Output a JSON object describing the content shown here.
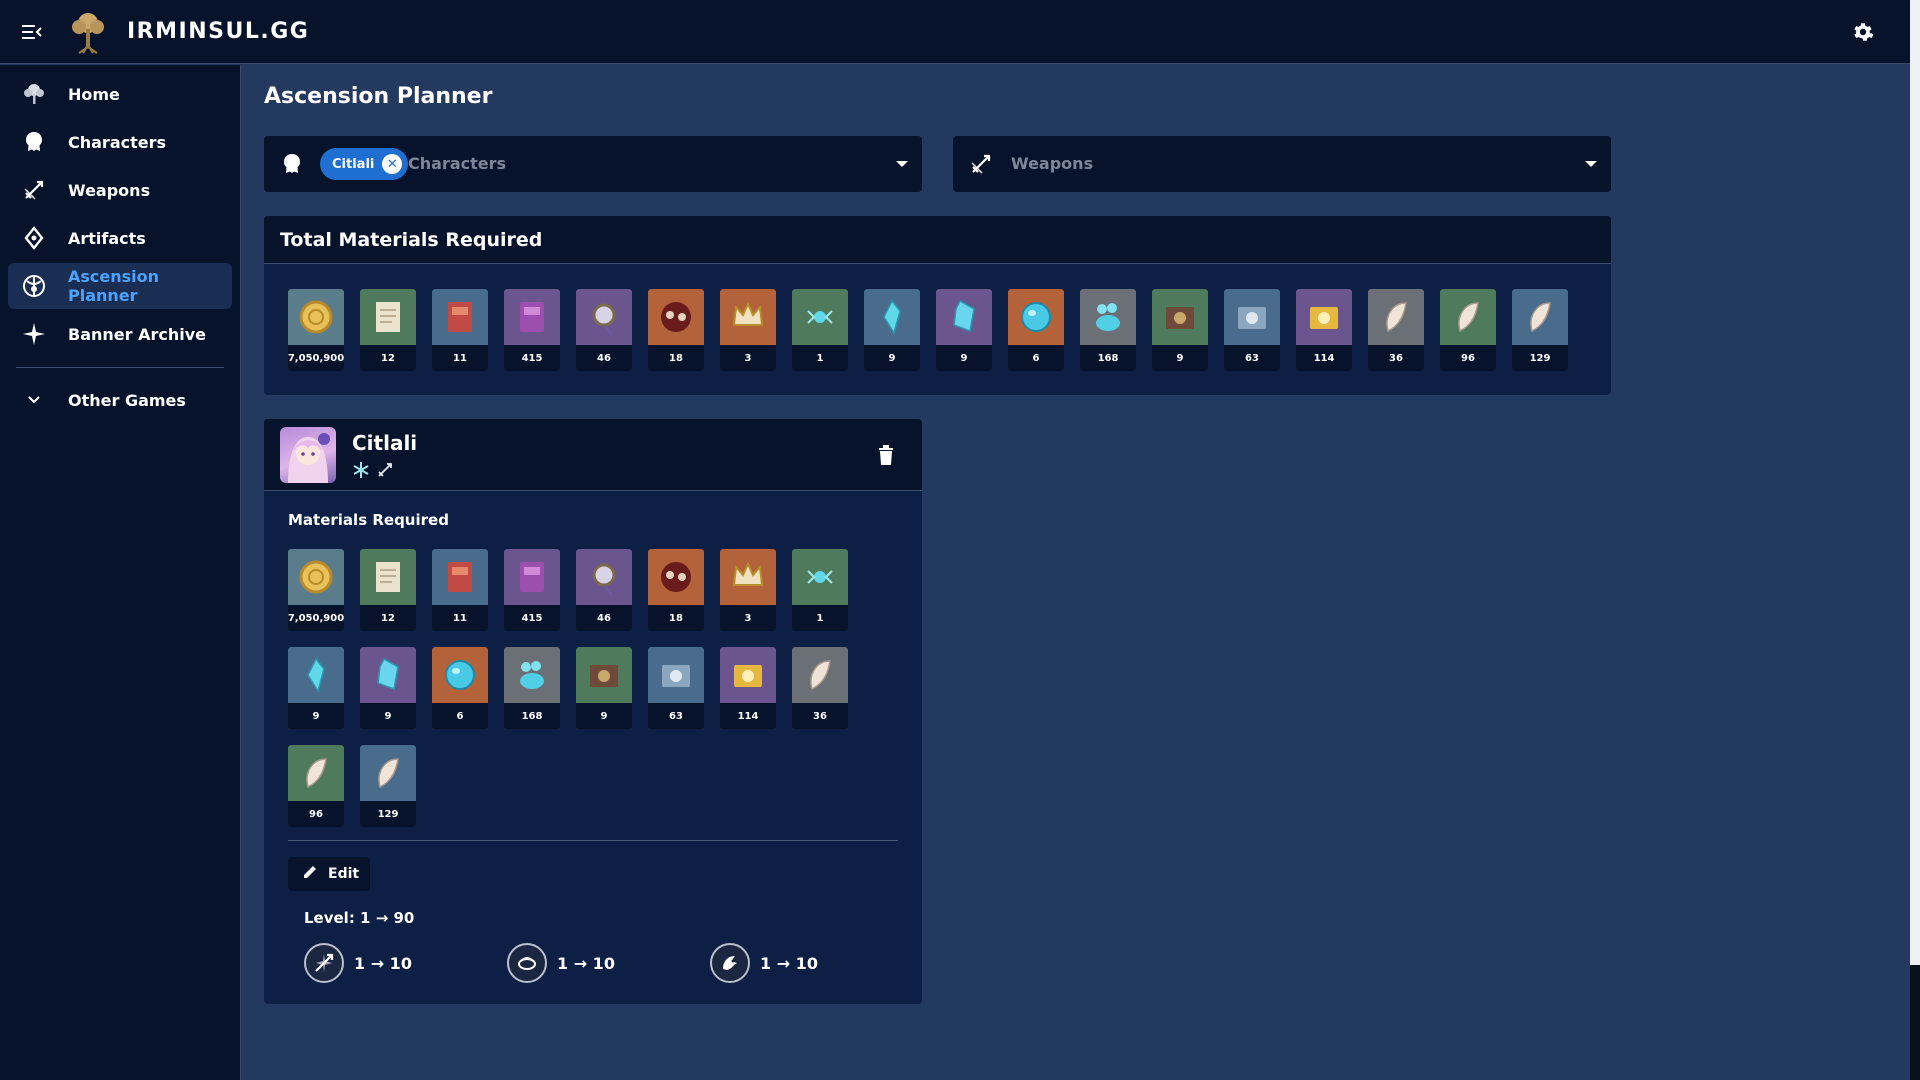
{
  "app": {
    "brand": "IRMINSUL.GG"
  },
  "sidebar": {
    "items": [
      {
        "label": "Home",
        "icon": "tree-icon"
      },
      {
        "label": "Characters",
        "icon": "character-head-icon"
      },
      {
        "label": "Weapons",
        "icon": "sword-icon"
      },
      {
        "label": "Artifacts",
        "icon": "artifact-icon"
      },
      {
        "label": "Ascension Planner",
        "icon": "ascension-icon",
        "active": true
      },
      {
        "label": "Banner Archive",
        "icon": "sparkle-icon"
      }
    ],
    "other_games": {
      "label": "Other Games",
      "icon": "chevron-down-icon"
    }
  },
  "page": {
    "title": "Ascension Planner"
  },
  "selectors": {
    "characters": {
      "chip": "Citlali",
      "placeholder": "Characters"
    },
    "weapons": {
      "placeholder": "Weapons"
    }
  },
  "total": {
    "title": "Total Materials Required",
    "materials": [
      {
        "qty": "7,050,900",
        "icon": "mora-coin-icon",
        "bg": "#5b7c8a"
      },
      {
        "qty": "12",
        "icon": "talent-book-green-icon",
        "bg": "#4f7a5c"
      },
      {
        "qty": "11",
        "icon": "talent-book-blue-icon",
        "bg": "#4a6c8c"
      },
      {
        "qty": "415",
        "icon": "talent-book-purple-icon",
        "bg": "#6a558e"
      },
      {
        "qty": "46",
        "icon": "boss-drop-icon",
        "bg": "#6a558e"
      },
      {
        "qty": "18",
        "icon": "weekly-boss-icon",
        "bg": "#b4623a"
      },
      {
        "qty": "3",
        "icon": "crown-icon",
        "bg": "#b4623a"
      },
      {
        "qty": "1",
        "icon": "gem-sliver-icon",
        "bg": "#4f7a5c"
      },
      {
        "qty": "9",
        "icon": "gem-fragment-icon",
        "bg": "#4a6c8c"
      },
      {
        "qty": "9",
        "icon": "gem-chunk-icon",
        "bg": "#6a558e"
      },
      {
        "qty": "6",
        "icon": "gem-icon",
        "bg": "#b4623a"
      },
      {
        "qty": "168",
        "icon": "specialty-icon",
        "bg": "#6b6f76"
      },
      {
        "qty": "9",
        "icon": "common-item-green-icon",
        "bg": "#4f7a5c"
      },
      {
        "qty": "63",
        "icon": "common-item-blue-icon",
        "bg": "#4a6c8c"
      },
      {
        "qty": "114",
        "icon": "common-item-purple-icon",
        "bg": "#6a558e"
      },
      {
        "qty": "36",
        "icon": "feather-grey-icon",
        "bg": "#6b6f76"
      },
      {
        "qty": "96",
        "icon": "feather-green-icon",
        "bg": "#4f7a5c"
      },
      {
        "qty": "129",
        "icon": "feather-blue-icon",
        "bg": "#4a6c8c"
      }
    ]
  },
  "character": {
    "name": "Citlali",
    "elements": [
      "cryo-icon",
      "catalyst-icon"
    ],
    "materials_label": "Materials Required",
    "edit_label": "Edit",
    "level": "Level: 1 → 90",
    "talents": [
      {
        "icon": "normal-attack-icon",
        "range": "1 → 10"
      },
      {
        "icon": "elemental-skill-icon",
        "range": "1 → 10"
      },
      {
        "icon": "elemental-burst-icon",
        "range": "1 → 10"
      }
    ]
  }
}
